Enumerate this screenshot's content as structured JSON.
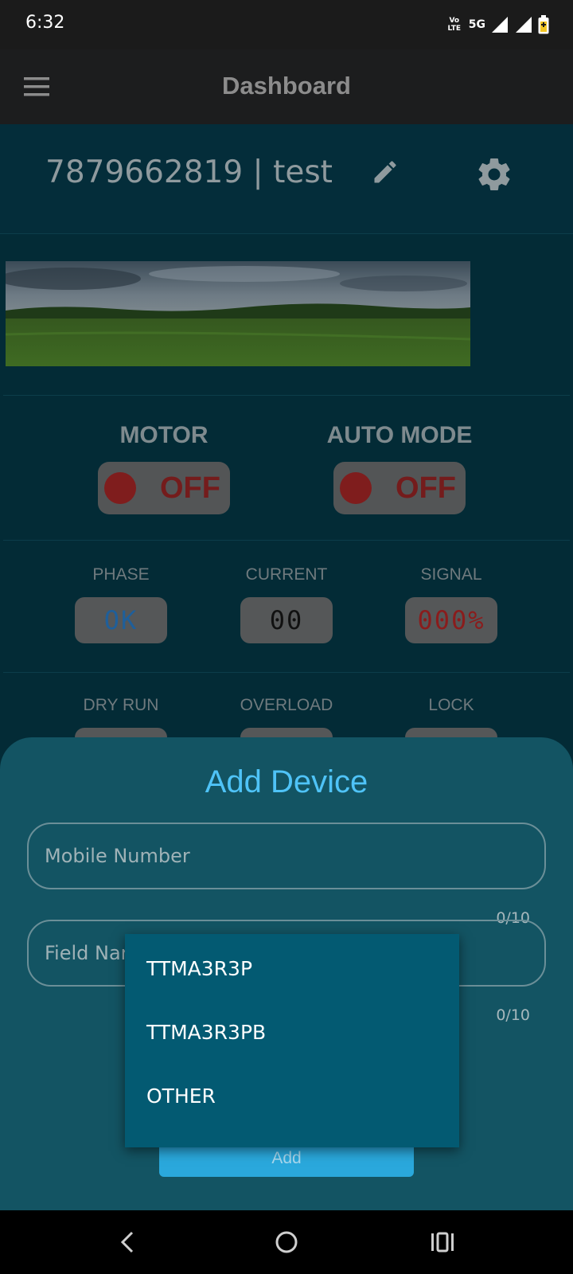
{
  "status_bar": {
    "time": "6:32",
    "volte": "Vo LTE",
    "network": "5G"
  },
  "app_bar": {
    "title": "Dashboard",
    "menu_icon": "hamburger-menu-icon"
  },
  "device": {
    "title": "7879662819 | test",
    "edit_icon": "pencil-icon",
    "settings_icon": "gear-icon"
  },
  "controls": {
    "motor": {
      "label": "MOTOR",
      "state": "OFF"
    },
    "auto_mode": {
      "label": "AUTO MODE",
      "state": "OFF"
    }
  },
  "metrics_row1": [
    {
      "label": "PHASE",
      "value": "OK",
      "color": "#1f5f9a"
    },
    {
      "label": "CURRENT",
      "value": "00",
      "color": "#111111"
    },
    {
      "label": "SIGNAL",
      "value": "000%",
      "color": "#8a1c1c"
    }
  ],
  "metrics_row2": [
    {
      "label": "DRY RUN"
    },
    {
      "label": "OVERLOAD"
    },
    {
      "label": "LOCK"
    }
  ],
  "add_device": {
    "title": "Add Device",
    "mobile_placeholder": "Mobile Number",
    "mobile_counter": "0/10",
    "field_placeholder": "Field Nar",
    "field_counter": "0/10",
    "add_button": "Add"
  },
  "dropdown": {
    "options": [
      "TTMA3R3P",
      "TTMA3R3PB",
      "OTHER"
    ]
  },
  "colors": {
    "accent": "#4fc3f7",
    "sheet": "#135463",
    "dropdown": "#035a72",
    "off_red": "#7f1d1d"
  }
}
